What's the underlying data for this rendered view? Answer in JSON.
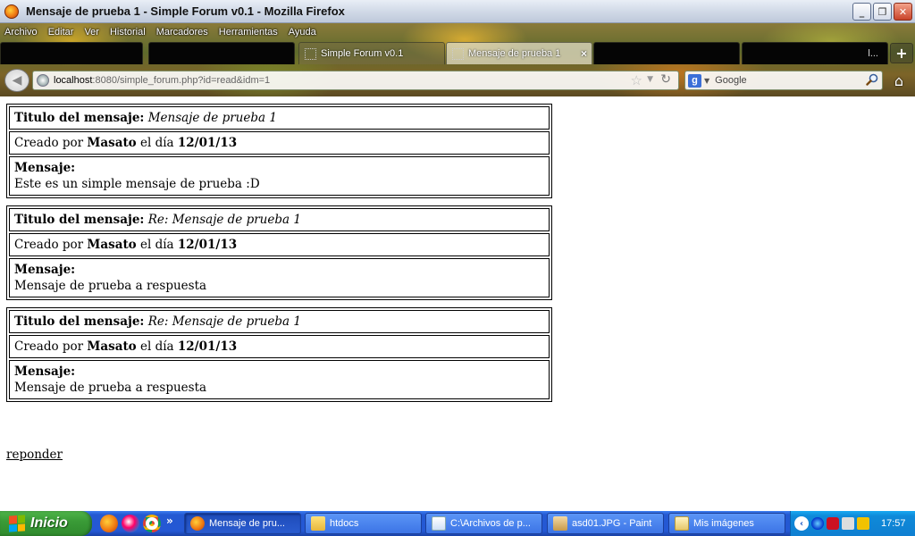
{
  "window": {
    "title": "Mensaje de prueba 1 - Simple Forum v0.1 - Mozilla Firefox",
    "minimize_glyph": "_",
    "maximize_glyph": "❐",
    "close_glyph": "✕"
  },
  "menu": [
    "Archivo",
    "Editar",
    "Ver",
    "Historial",
    "Marcadores",
    "Herramientas",
    "Ayuda"
  ],
  "tabs": [
    {
      "label": "",
      "state": "redacted"
    },
    {
      "label": "",
      "state": "redacted"
    },
    {
      "label": "Simple Forum v0.1",
      "state": "normal"
    },
    {
      "label": "Mensaje de prueba 1",
      "state": "active",
      "close": "×"
    },
    {
      "label": "",
      "state": "redacted"
    },
    {
      "label": "",
      "state": "redacted",
      "suffix": "l..."
    }
  ],
  "new_tab_label": "+",
  "address": {
    "host": "localhost",
    "path": ":8080/simple_forum.php?id=read&idm=1"
  },
  "search": {
    "engine_letter": "g",
    "placeholder": "Google"
  },
  "posts": [
    {
      "title_label": "Titulo del mensaje:",
      "title": "Mensaje de prueba 1",
      "created_prefix": "Creado por",
      "author": "Masato",
      "created_mid": "el día",
      "date": "12/01/13",
      "body_label": "Mensaje:",
      "body": "Este es un simple mensaje de prueba :D"
    },
    {
      "title_label": "Titulo del mensaje:",
      "title": "Re: Mensaje de prueba 1",
      "created_prefix": "Creado por",
      "author": "Masato",
      "created_mid": "el día",
      "date": "12/01/13",
      "body_label": "Mensaje:",
      "body": "Mensaje de prueba a respuesta"
    },
    {
      "title_label": "Titulo del mensaje:",
      "title": "Re: Mensaje de prueba 1",
      "created_prefix": "Creado por",
      "author": "Masato",
      "created_mid": "el día",
      "date": "12/01/13",
      "body_label": "Mensaje:",
      "body": "Mensaje de prueba a respuesta"
    }
  ],
  "reply_link": "reponder",
  "taskbar": {
    "start_label": "Inicio",
    "quicklaunch_more": "»",
    "tasks": [
      {
        "label": "Mensaje de pru...",
        "icon": "firefox-icon"
      },
      {
        "label": "htdocs",
        "icon": "folder-icon"
      },
      {
        "label": "C:\\Archivos de p...",
        "icon": "notepad-icon"
      },
      {
        "label": "asd01.JPG - Paint",
        "icon": "paint-icon"
      },
      {
        "label": "Mis imágenes",
        "icon": "pictures-folder-icon"
      }
    ],
    "clock": "17:57"
  }
}
